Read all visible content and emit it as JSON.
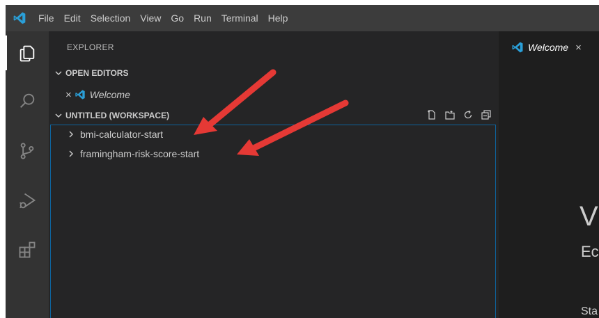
{
  "menu": [
    "File",
    "Edit",
    "Selection",
    "View",
    "Go",
    "Run",
    "Terminal",
    "Help"
  ],
  "sidebar": {
    "title": "EXPLORER",
    "open_editors": {
      "label": "OPEN EDITORS",
      "items": [
        {
          "close": "×",
          "name": "Welcome"
        }
      ]
    },
    "workspace": {
      "label": "UNTITLED (WORKSPACE)",
      "folders": [
        "bmi-calculator-start",
        "framingham-risk-score-start"
      ]
    }
  },
  "editor": {
    "tab": {
      "label": "Welcome",
      "close": "×"
    },
    "welcome_title_partial": "V",
    "welcome_sub_partial": "Ec",
    "welcome_start_partial": "Sta"
  },
  "colors": {
    "accent": "#0e639c",
    "vscode_blue": "#2a9fd8",
    "arrow_red": "#e53935"
  },
  "icons": {
    "activity": [
      "explorer-icon",
      "search-icon",
      "source-control-icon",
      "run-debug-icon",
      "extensions-icon"
    ],
    "workspace_actions": [
      "new-file-icon",
      "new-folder-icon",
      "refresh-icon",
      "collapse-all-icon"
    ]
  }
}
